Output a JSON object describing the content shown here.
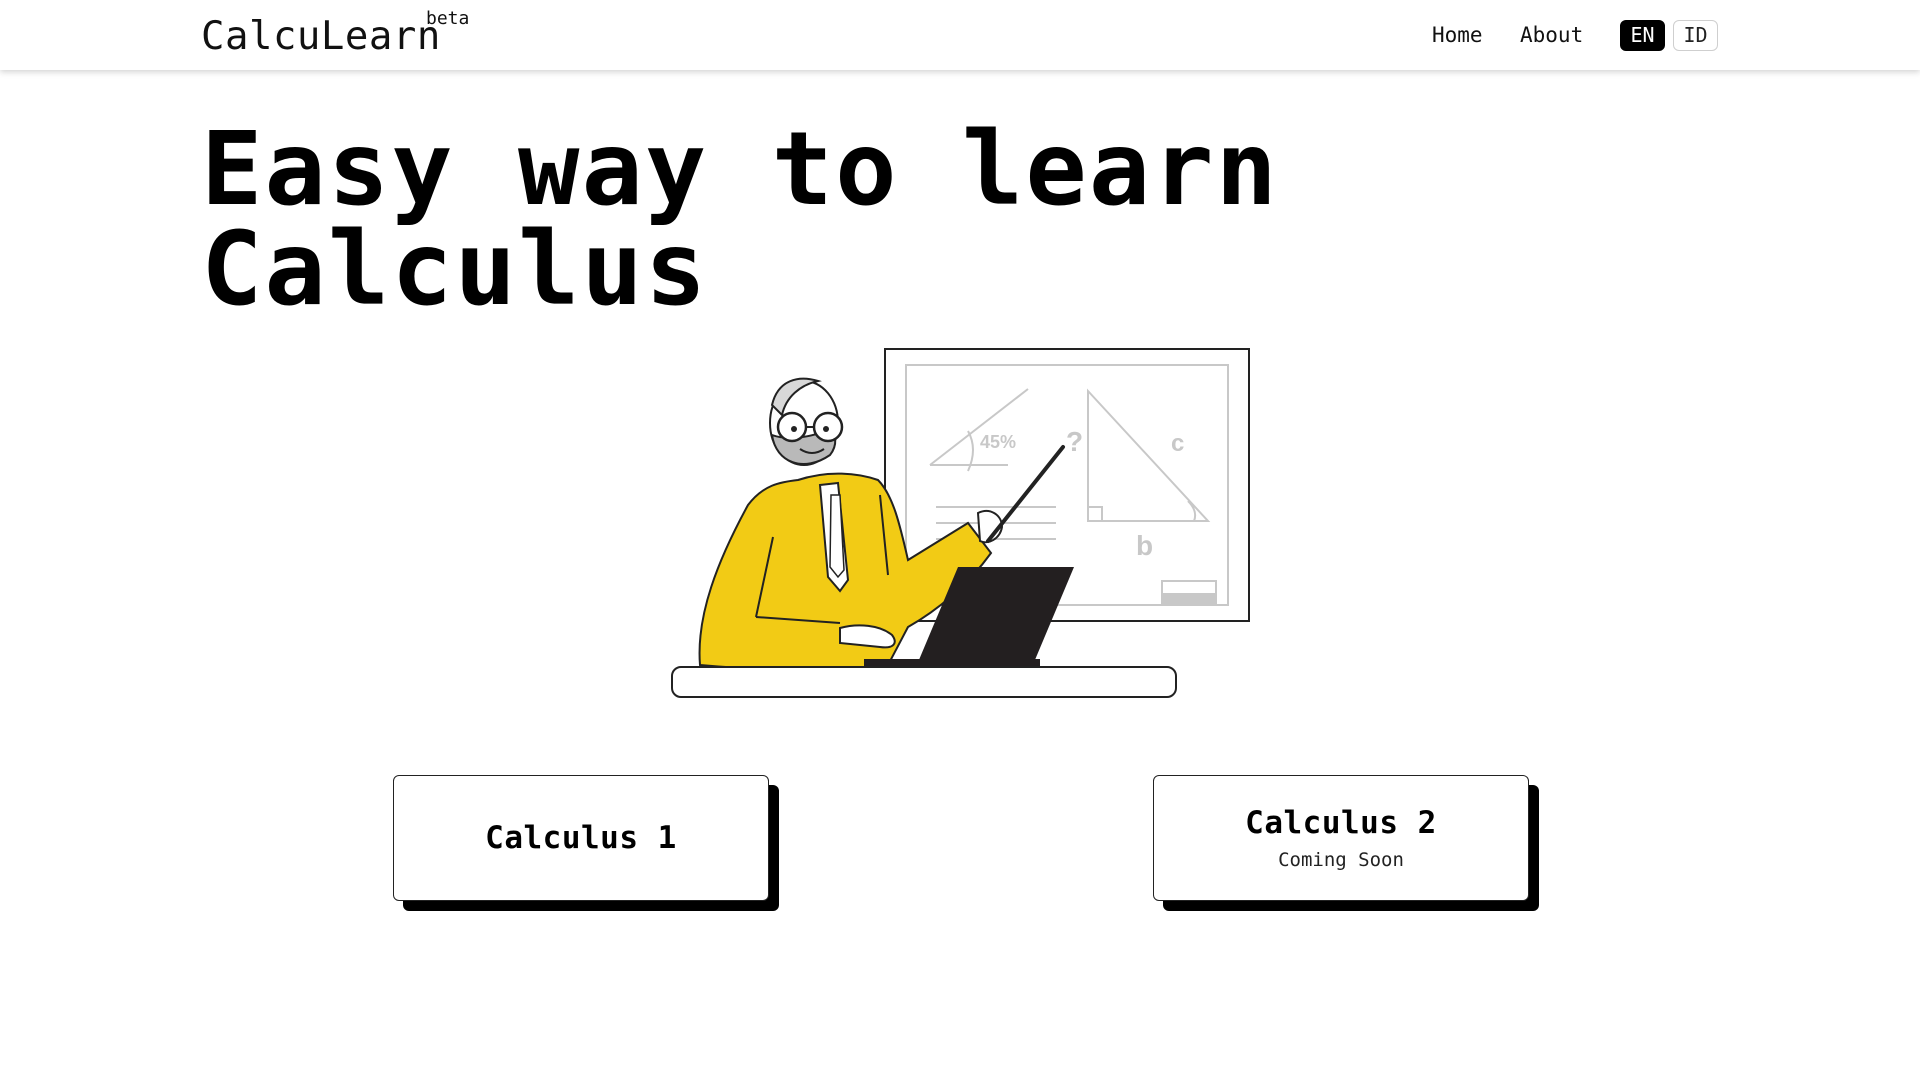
{
  "navbar": {
    "brand": "CalcuLearn",
    "badge": "beta",
    "links": {
      "home": "Home",
      "about": "About"
    },
    "languages": {
      "en": "EN",
      "id": "ID",
      "active": "EN"
    }
  },
  "hero": {
    "title_line1": "Easy way to learn",
    "title_line2": "Calculus"
  },
  "illustration": {
    "board_labels": {
      "angle": "45%",
      "question": "?",
      "side_c": "c",
      "side_b": "b"
    }
  },
  "courses": [
    {
      "title": "Calculus 1",
      "subtitle": ""
    },
    {
      "title": "Calculus 2",
      "subtitle": "Coming Soon"
    }
  ],
  "colors": {
    "accent_yellow": "#f2cb15",
    "active_lang_bg": "#000000",
    "card_shadow": "#000000"
  }
}
